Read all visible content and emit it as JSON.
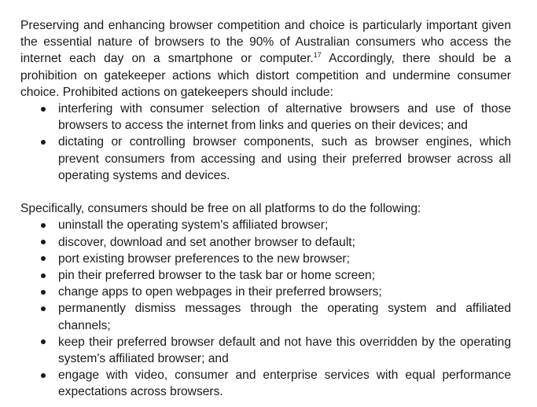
{
  "section1": {
    "intro_part1": "Preserving and enhancing browser competition and choice is particularly important given the essential nature of browsers to the 90% of Australian consumers who access the internet each day on a smartphone or computer.",
    "footnote_ref": "17",
    "intro_part2": " Accordingly, there should be a prohibition on gatekeeper actions which distort competition and undermine consumer choice. Prohibited actions on gatekeepers should include:",
    "bullets": [
      "interfering with consumer selection of alternative browsers and use of those browsers to access the internet from links and queries on their devices; and",
      "dictating or controlling browser components, such as browser engines, which prevent consumers from accessing and using their preferred browser across all operating systems and devices."
    ]
  },
  "section2": {
    "intro": "Specifically, consumers should be free on all platforms to do the following:",
    "bullets": [
      "uninstall the operating system's affiliated browser;",
      "discover, download and set another browser to default;",
      "port existing browser preferences to the new browser;",
      "pin their preferred browser to the task bar or home screen;",
      "change apps to open webpages in their preferred browsers;",
      "permanently dismiss messages through the operating system and affiliated channels;",
      "keep their preferred browser default and not have this overridden by the operating system's affiliated browser; and",
      "engage with video, consumer and enterprise services with equal performance expectations across browsers."
    ]
  }
}
